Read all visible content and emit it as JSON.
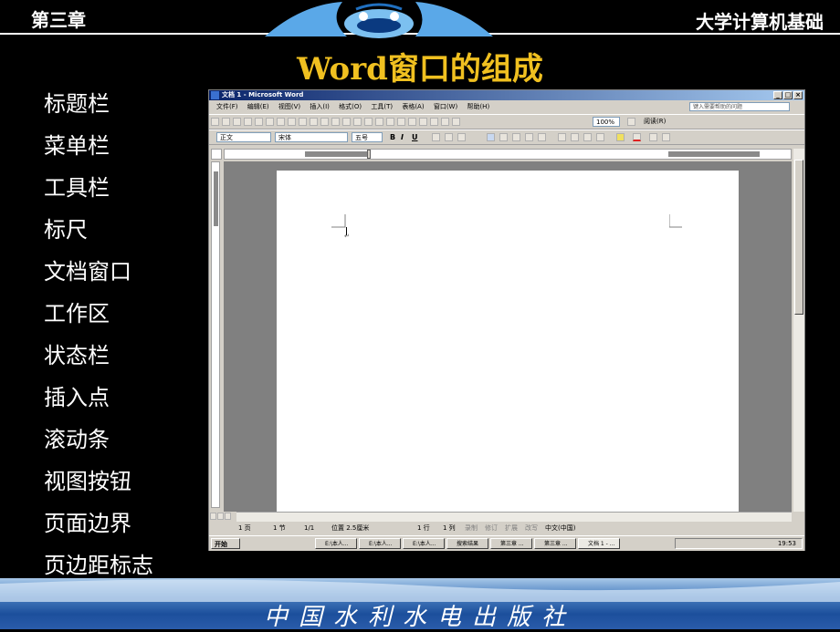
{
  "slide": {
    "chapter": "第三章",
    "course": "大学计算机基础",
    "title": "Word窗口的组成",
    "terms": [
      "标题栏",
      "菜单栏",
      "工具栏",
      "标尺",
      "文档窗口",
      "工作区",
      "状态栏",
      "插入点",
      "滚动条",
      "视图按钮",
      "页面边界",
      "页边距标志"
    ],
    "publisher": "中国水利水电出版社"
  },
  "word": {
    "window_title": "文档 1 - Microsoft Word",
    "menu": [
      "文件(F)",
      "编辑(E)",
      "视图(V)",
      "插入(I)",
      "格式(O)",
      "工具(T)",
      "表格(A)",
      "窗口(W)",
      "帮助(H)"
    ],
    "help_placeholder": "键入需要帮助的问题",
    "zoom": "100%",
    "read_button": "阅读(R)",
    "style": "正文",
    "font": "宋体",
    "size": "五号",
    "format_buttons": [
      "B",
      "I",
      "U"
    ],
    "status": {
      "page": "1 页",
      "section": "1 节",
      "page_of": "1/1",
      "position": "位置 2.5厘米",
      "line": "1 行",
      "column": "1 列",
      "rec": "录制",
      "trk": "修订",
      "ext": "扩展",
      "ovr": "改写",
      "lang": "中文(中国)"
    },
    "taskbar": {
      "start": "开始",
      "tasks": [
        "E:\\本人...",
        "E:\\本人...",
        "E:\\本人...",
        "搜索结果",
        "第三章 ...",
        "第三章 ...",
        "文档 1 - ..."
      ],
      "clock": "19:53"
    }
  },
  "colors": {
    "title_accent": "#f0c020",
    "footer_blue": "#1c4f9c",
    "titlebar": "#0a246a"
  }
}
